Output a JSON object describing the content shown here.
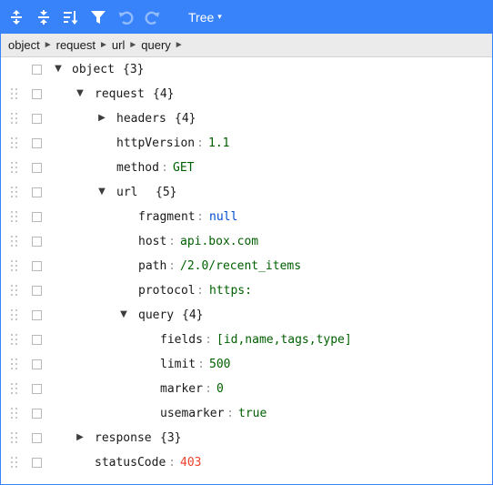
{
  "toolbar": {
    "buttons": [
      {
        "name": "expand-all-icon",
        "enabled": true
      },
      {
        "name": "collapse-all-icon",
        "enabled": true
      },
      {
        "name": "sort-icon",
        "enabled": true
      },
      {
        "name": "filter-icon",
        "enabled": true
      },
      {
        "name": "undo-icon",
        "enabled": false
      },
      {
        "name": "redo-icon",
        "enabled": false
      }
    ],
    "mode_label": "Tree",
    "mode_caret": "▾",
    "background": "#3883fa"
  },
  "breadcrumb": [
    "object",
    "request",
    "url",
    "query"
  ],
  "breadcrumb_sep": "►",
  "tree": [
    {
      "key": "object",
      "count": "{3}",
      "expanded": true,
      "root": true
    },
    {
      "key": "request",
      "count": "{4}",
      "expanded": true
    },
    {
      "key": "headers",
      "count": "{4}",
      "expanded": false
    },
    {
      "key": "httpVersion",
      "value": "1.1",
      "type": "string"
    },
    {
      "key": "method",
      "value": "GET",
      "type": "string"
    },
    {
      "key": "url",
      "count": "{5}",
      "expanded": true
    },
    {
      "key": "fragment",
      "value": "null",
      "type": "null"
    },
    {
      "key": "host",
      "value": "api.box.com",
      "type": "string"
    },
    {
      "key": "path",
      "value": "/2.0/recent_items",
      "type": "string"
    },
    {
      "key": "protocol",
      "value": "https:",
      "type": "string"
    },
    {
      "key": "query",
      "count": "{4}",
      "expanded": true
    },
    {
      "key": "fields",
      "value": "[id,name,tags,type]",
      "type": "string"
    },
    {
      "key": "limit",
      "value": "500",
      "type": "string"
    },
    {
      "key": "marker",
      "value": "0",
      "type": "string"
    },
    {
      "key": "usemarker",
      "value": "true",
      "type": "string"
    },
    {
      "key": "response",
      "count": "{3}",
      "expanded": false
    },
    {
      "key": "statusCode",
      "value": "403",
      "type": "number"
    }
  ],
  "separator": ":",
  "colors": {
    "string": "#006000",
    "number": "#ee422e",
    "null": "#004ed0",
    "accent": "#3883fa"
  }
}
